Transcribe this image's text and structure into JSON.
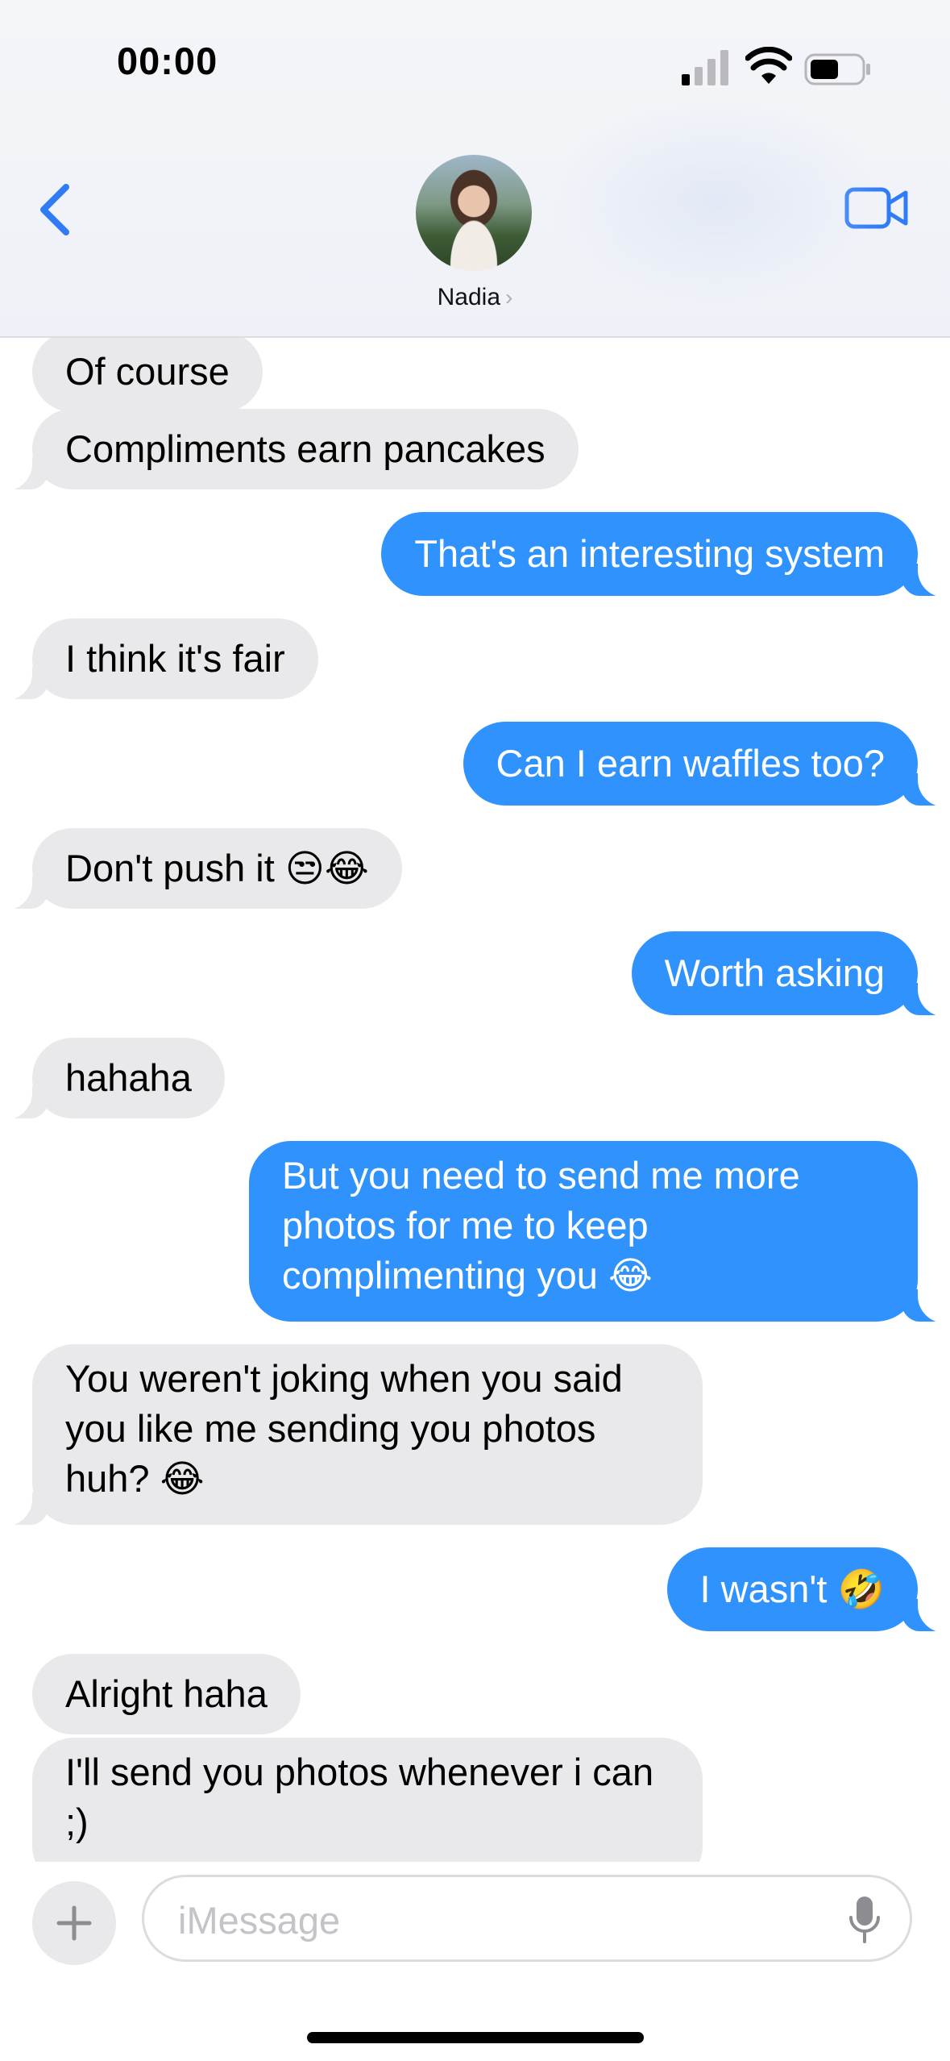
{
  "status_bar": {
    "time": "00:00"
  },
  "header": {
    "contact_name": "Nadia",
    "chevron": "›"
  },
  "messages": [
    {
      "side": "received",
      "text": "Of course"
    },
    {
      "side": "received",
      "text": "Compliments earn pancakes"
    },
    {
      "side": "sent",
      "text": "That's an interesting system"
    },
    {
      "side": "received",
      "text": "I think it's fair"
    },
    {
      "side": "sent",
      "text": "Can I earn waffles too?"
    },
    {
      "side": "received",
      "text": "Don't push it 😒😂"
    },
    {
      "side": "sent",
      "text": "Worth asking"
    },
    {
      "side": "received",
      "text": "hahaha"
    },
    {
      "side": "sent",
      "text": "But you need to send me more photos for me to keep complimenting you 😂"
    },
    {
      "side": "received",
      "text": "You weren't joking when you said you like me sending you photos huh? 😂"
    },
    {
      "side": "sent",
      "text": "I wasn't 🤣"
    },
    {
      "side": "received",
      "text": "Alright haha"
    },
    {
      "side": "received",
      "text": "I'll send you photos whenever i can ;)"
    }
  ],
  "composer": {
    "placeholder": "iMessage",
    "value": ""
  },
  "colors": {
    "sent_bubble": "#3093fd",
    "received_bubble": "#e9e9eb",
    "accent": "#2f7cf6"
  },
  "icons": [
    "signal-icon",
    "wifi-icon",
    "battery-icon",
    "back-chevron-icon",
    "video-camera-icon",
    "plus-icon",
    "microphone-icon"
  ]
}
